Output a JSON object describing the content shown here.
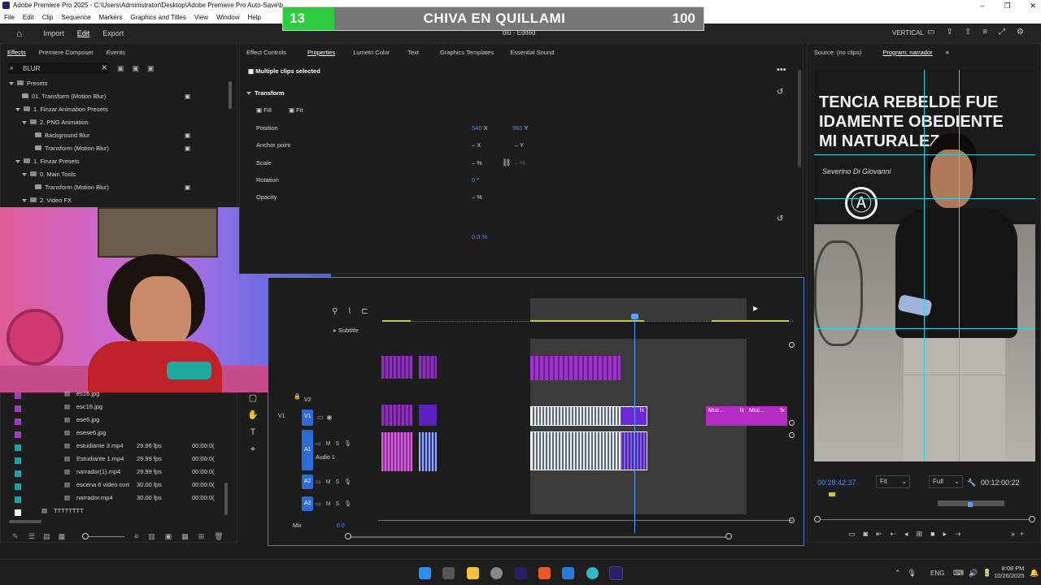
{
  "window": {
    "title": "Adobe Premiere Pro 2025 - C:\\Users\\Administrator\\Desktop\\Adobe Premiere Pro Auto-Save\\b",
    "min": "–",
    "max": "❐",
    "close": "✕"
  },
  "menu": [
    "File",
    "Edit",
    "Clip",
    "Sequence",
    "Markers",
    "Graphics and Titles",
    "View",
    "Window",
    "Help"
  ],
  "scoreboard": {
    "number": "13",
    "team": "CHIVA EN QUILLAMI",
    "points": "100"
  },
  "header": {
    "tabs": [
      "Import",
      "Edit",
      "Export"
    ],
    "active": "Edit",
    "doc": "blu",
    "doc_status": "- Edited",
    "layout": "VERTICAL"
  },
  "effects": {
    "tabs": [
      "Effects",
      "Premiere Composer",
      "Events"
    ],
    "search": "BLUR",
    "tree": [
      {
        "label": "Presets",
        "depth": 0,
        "kind": "folder"
      },
      {
        "label": "01. Transform (Motion Blur)",
        "depth": 1,
        "kind": "item"
      },
      {
        "label": "1. Finzar Animation Presets",
        "depth": 1,
        "kind": "folder"
      },
      {
        "label": "2. PNG Animation",
        "depth": 2,
        "kind": "folder"
      },
      {
        "label": "Background Blur",
        "depth": 3,
        "kind": "item"
      },
      {
        "label": "Transform (Motion Blur)",
        "depth": 3,
        "kind": "item"
      },
      {
        "label": "1. Finzar Presets",
        "depth": 1,
        "kind": "folder"
      },
      {
        "label": "0. Main Tools",
        "depth": 2,
        "kind": "folder"
      },
      {
        "label": "Transform (Motion Blur)",
        "depth": 3,
        "kind": "item"
      },
      {
        "label": "2. Video FX",
        "depth": 2,
        "kind": "folder"
      }
    ]
  },
  "project": {
    "items": [
      {
        "name": "es16.jpg",
        "fps": "",
        "dur": "",
        "color": "#a23ec0"
      },
      {
        "name": "esc16.jpg",
        "fps": "",
        "dur": "",
        "color": "#a23ec0"
      },
      {
        "name": "ese6.jpg",
        "fps": "",
        "dur": "",
        "color": "#a23ec0"
      },
      {
        "name": "esese6.jpg",
        "fps": "",
        "dur": "",
        "color": "#a23ec0"
      },
      {
        "name": "estudiante 3.mp4",
        "fps": "29.96 fps",
        "dur": "00:00:0(",
        "color": "#1fa0a8"
      },
      {
        "name": "Estudiante 1.mp4",
        "fps": "29.99 fps",
        "dur": "00:00:0(",
        "color": "#1fa0a8"
      },
      {
        "name": "narrador(1).mp4",
        "fps": "29.99 fps",
        "dur": "00:00:0(",
        "color": "#1fa0a8"
      },
      {
        "name": "escena 6 video cort",
        "fps": "30.00 fps",
        "dur": "00:00:0(",
        "color": "#1fa0a8"
      },
      {
        "name": "narrador.mp4",
        "fps": "30.00 fps",
        "dur": "00:00:0(",
        "color": "#1fa0a8"
      },
      {
        "name": "TTTTTTTT",
        "fps": "",
        "dur": "",
        "color": "#ffffff"
      }
    ]
  },
  "properties": {
    "tabs": [
      "Effect Controls",
      "Properties",
      "Lumetri Color",
      "Text",
      "Graphics Templates",
      "Essential Sound"
    ],
    "active": "Properties",
    "selection": "Multiple clips selected",
    "section": "Transform",
    "fill": "Fill",
    "fit": "Fit",
    "rows": [
      {
        "label": "Position",
        "v1": "540",
        "u1": "X",
        "v2": "960",
        "u2": "Y"
      },
      {
        "label": "Anchor point",
        "v1": "–",
        "u1": "X",
        "v2": "–",
        "u2": "Y"
      },
      {
        "label": "Scale",
        "v1": "–",
        "u1": "%",
        "v2": "–",
        "u2": "%"
      },
      {
        "label": "Rotation",
        "v1": "0",
        "u1": "°",
        "v2": "",
        "u2": ""
      },
      {
        "label": "Opacity",
        "v1": "–",
        "u1": "%",
        "v2": "",
        "u2": ""
      }
    ],
    "extra_value": "0.0 %"
  },
  "timeline": {
    "tracks": {
      "subtitle": "Subtitle",
      "v2": "V2",
      "v1": "V1",
      "a1": "A1",
      "audio1": "Audio 1",
      "a2": "A2",
      "a3": "A3",
      "mix": "Mix",
      "mix_value": "0.0"
    },
    "clip_labels": [
      "Muc...",
      "Muc..."
    ],
    "fx": "fx"
  },
  "program": {
    "source_tab": "Source: (no clips)",
    "program_tab": "Program: narrador",
    "timecode": "00:28:42:37",
    "fit": "Fit",
    "quality": "Full",
    "duration": "00:12:00:22",
    "poster_lines": [
      "TENCIA REBELDE FUE",
      "IDAMENTE OBEDIENTE",
      "MI NATURALEZ"
    ],
    "poster_sig": "Severino Di Giovanni"
  },
  "taskbar": {
    "lang": "ENG",
    "time": "8:08 PM",
    "date": "10/26/2025"
  }
}
